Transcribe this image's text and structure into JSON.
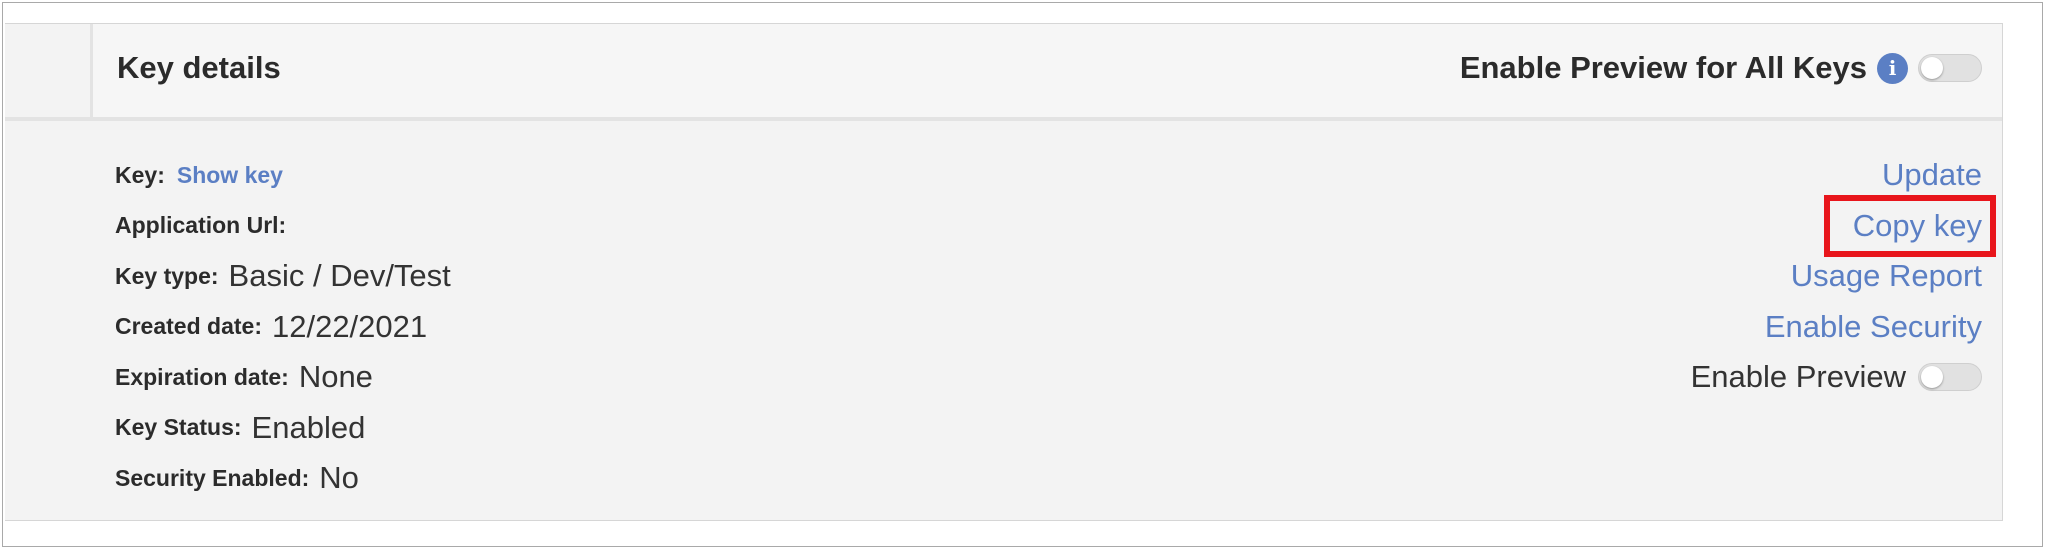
{
  "header": {
    "title": "Key details",
    "enable_preview_all_label": "Enable Preview for All Keys"
  },
  "details": {
    "key_label": "Key:",
    "show_key_link": "Show key",
    "application_url_label": "Application Url:",
    "application_url_value": "",
    "key_type_label": "Key type:",
    "key_type_value": "Basic / Dev/Test",
    "created_date_label": "Created date:",
    "created_date_value": "12/22/2021",
    "expiration_date_label": "Expiration date:",
    "expiration_date_value": "None",
    "key_status_label": "Key Status:",
    "key_status_value": "Enabled",
    "security_enabled_label": "Security Enabled:",
    "security_enabled_value": "No"
  },
  "actions": {
    "update": "Update",
    "copy_key": "Copy key",
    "usage_report": "Usage Report",
    "enable_security": "Enable Security",
    "enable_preview": "Enable Preview"
  },
  "toggles": {
    "enable_preview_all": false,
    "enable_preview": false
  },
  "icons": {
    "info": "info-icon"
  },
  "colors": {
    "link": "#5b7fc4",
    "highlight_box": "#e8151b",
    "panel_background": "#f3f3f3"
  }
}
